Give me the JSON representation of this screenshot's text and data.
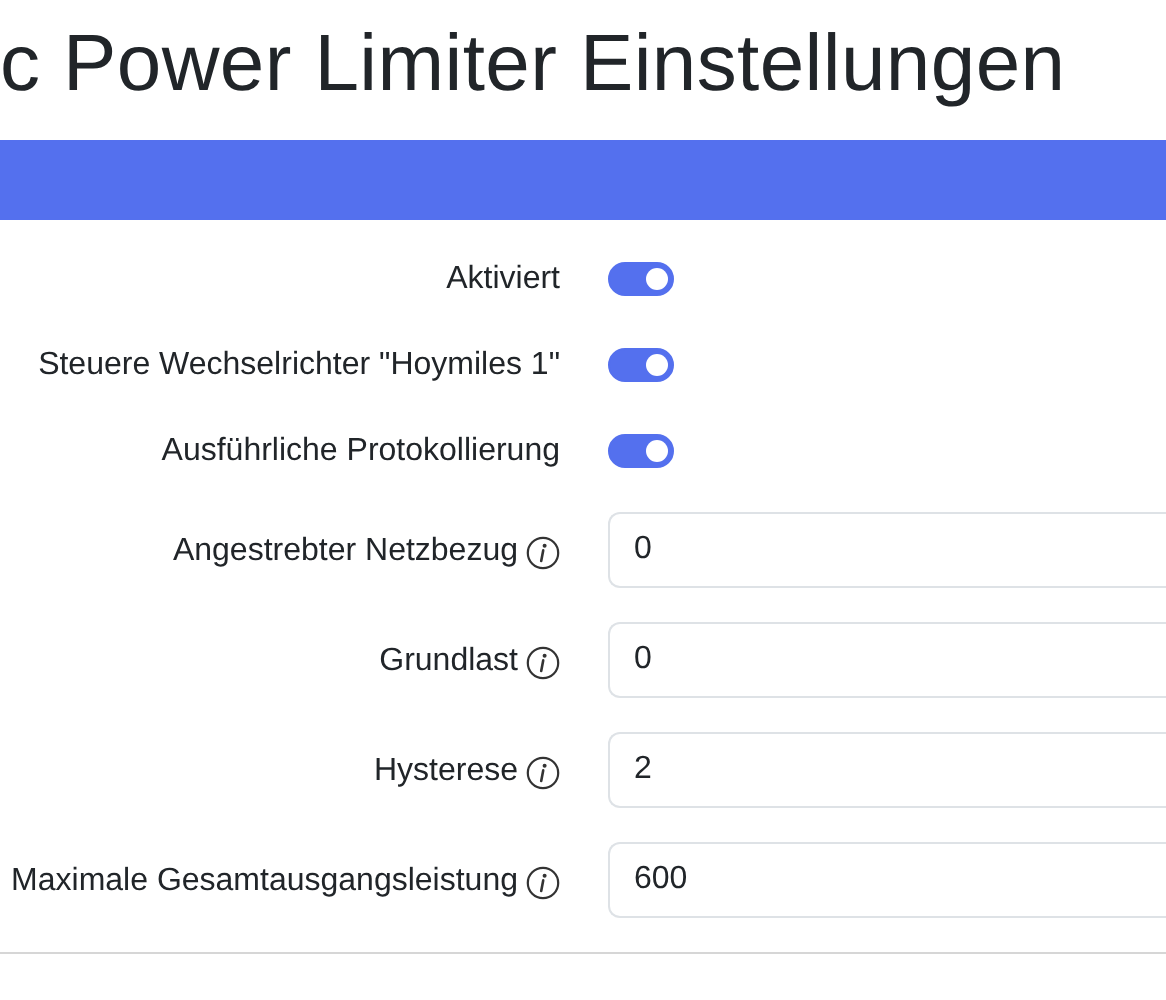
{
  "title": "c Power Limiter Einstellungen",
  "card_header": {
    "kind": "bar"
  },
  "toggles": [
    {
      "label": "Aktiviert",
      "on": true
    },
    {
      "label": "Steuere Wechselrichter \"Hoymiles 1\"",
      "on": true
    },
    {
      "label": "Ausführliche Protokollierung",
      "on": true
    }
  ],
  "fields": [
    {
      "label": "Angestrebter Netzbezug",
      "value": "0"
    },
    {
      "label": "Grundlast",
      "value": "0"
    },
    {
      "label": "Hysterese",
      "value": "2"
    },
    {
      "label": "Maximale Gesamtausgangsleistung",
      "value": "600"
    }
  ]
}
